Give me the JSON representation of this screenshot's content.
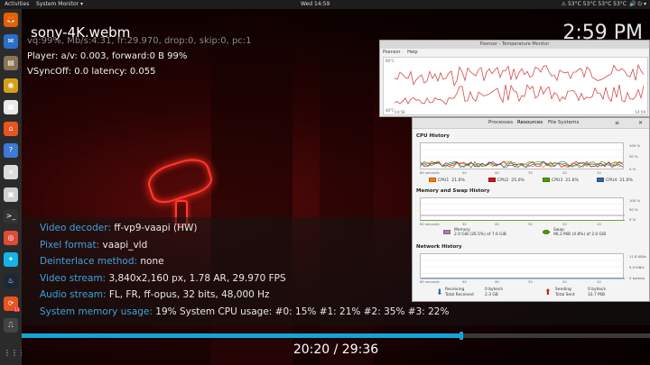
{
  "topbar": {
    "activities": "Activities",
    "app_menu": "System Monitor ▾",
    "clock": "Wed 14:59",
    "status": "⚠ 53°C 53°C 53°C 53°C",
    "sys_icons": "🔊 ⏻ ▾"
  },
  "dock": {
    "items": [
      {
        "icon": "firefox-icon",
        "glyph": "🦊",
        "color": "#e66000"
      },
      {
        "icon": "thunderbird-icon",
        "glyph": "✉",
        "color": "#2a6fc9"
      },
      {
        "icon": "files-icon",
        "glyph": "▤",
        "color": "#8a7355"
      },
      {
        "icon": "rhythmbox-icon",
        "glyph": "◉",
        "color": "#d4a017"
      },
      {
        "icon": "writer-icon",
        "glyph": "▦",
        "color": "#e8e8e8"
      },
      {
        "icon": "software-icon",
        "glyph": "⌂",
        "color": "#e95420"
      },
      {
        "icon": "help-icon",
        "glyph": "?",
        "color": "#3d7ad6"
      },
      {
        "icon": "amazon-icon",
        "glyph": "a",
        "color": "#dcdcdc"
      },
      {
        "icon": "screenshot-icon",
        "glyph": "▣",
        "color": "#cfcfcf"
      },
      {
        "icon": "terminal-icon",
        "glyph": ">_",
        "color": "#333333"
      },
      {
        "icon": "chrome-icon",
        "glyph": "◎",
        "color": "#dd4b39"
      },
      {
        "icon": "kodi-icon",
        "glyph": "✦",
        "color": "#17b2e7"
      },
      {
        "icon": "steam-icon",
        "glyph": "♨",
        "color": "#1b2838"
      },
      {
        "icon": "updates-icon",
        "glyph": "⟳",
        "color": "#e95420",
        "badge": "53"
      },
      {
        "icon": "system-monitor-icon",
        "glyph": "⎍",
        "color": "#444444"
      }
    ],
    "apps_grid": "⋮⋮⋮"
  },
  "osd": {
    "title": "sony-4K.webm",
    "clock": "2:59 PM",
    "line1": "vq:99%, Mb/s:4.31, fr:29.970, drop:0, skip:0, pc:1",
    "line2": "Player: a/v: 0.003,  forward:0 B 99%",
    "line3": "VSyncOff: 0.0 latency: 0.055"
  },
  "info": {
    "rows": [
      {
        "k": "Video decoder: ",
        "v": "ff-vp9-vaapi (HW)"
      },
      {
        "k": "Pixel format: ",
        "v": "vaapi_vld"
      },
      {
        "k": "Deinterlace method: ",
        "v": "none"
      },
      {
        "k": "Video stream: ",
        "v": "3,840x2,160 px, 1.78 AR, 29.970 FPS"
      },
      {
        "k": "Audio stream: ",
        "v": "FL, FR, ff-opus, 32 bits, 48,000 Hz"
      },
      {
        "k": "System memory usage: ",
        "v": "19%      System CPU usage: #0:  15% #1:  21% #2:  35% #3:  22%"
      }
    ]
  },
  "player": {
    "progress": 0.699,
    "timecode": "20:20 / 29:36"
  },
  "psensor": {
    "title": "Psensor - Temperature Monitor",
    "menu": [
      "Psensor",
      "Help"
    ],
    "y_top": "90°C",
    "y_bottom": "40°C",
    "x_left": "14:58",
    "x_right": "14:59",
    "colors": {
      "line": "#d44a4a"
    }
  },
  "sysmon": {
    "tabs": [
      "Processes",
      "Resources",
      "File Systems"
    ],
    "menu_btn": "≡",
    "close_btn": "✕",
    "cpu": {
      "title": "CPU History",
      "pct": [
        "100 %",
        "50 %",
        "0 %"
      ],
      "ticks": [
        "60 seconds",
        "50",
        "40",
        "30",
        "20",
        "10"
      ],
      "cores": [
        {
          "label": "CPU1",
          "value": "21.6%",
          "color": "#f57900"
        },
        {
          "label": "CPU2",
          "value": "25.0%",
          "color": "#c4161c"
        },
        {
          "label": "CPU3",
          "value": "21.6%",
          "color": "#4e9a06"
        },
        {
          "label": "CPU4",
          "value": "21.6%",
          "color": "#3465a4"
        }
      ]
    },
    "memory": {
      "title": "Memory and Swap History",
      "pct": [
        "100 %",
        "50 %",
        "0 %"
      ],
      "ticks": [
        "60 seconds",
        "50",
        "40",
        "30",
        "20",
        "10"
      ],
      "mem_label": "Memory",
      "mem_value": "2.0 GiB (26.5%) of 7.6 GiB",
      "swap_label": "Swap",
      "swap_value": "96.2 MiB (4.8%) of 2.0 GiB",
      "colors": {
        "memory": "#ad7fa8",
        "swap": "#4e9a06"
      }
    },
    "network": {
      "title": "Network History",
      "pct": [
        "11.8 KiB/s",
        "5.9 KiB/s",
        "0 bytes/s"
      ],
      "ticks": [
        "60 seconds",
        "50",
        "40",
        "30",
        "20",
        "10"
      ],
      "receiving": "Receiving",
      "recv_rate": "0 bytes/s",
      "total_received": "Total Received",
      "recv_total": "2.3 GB",
      "sending": "Sending",
      "send_rate": "0 bytes/s",
      "total_sent": "Total Sent",
      "sent_total": "33.7 MiB",
      "colors": {
        "receiving": "#3465a4",
        "sending": "#c4161c"
      }
    }
  }
}
